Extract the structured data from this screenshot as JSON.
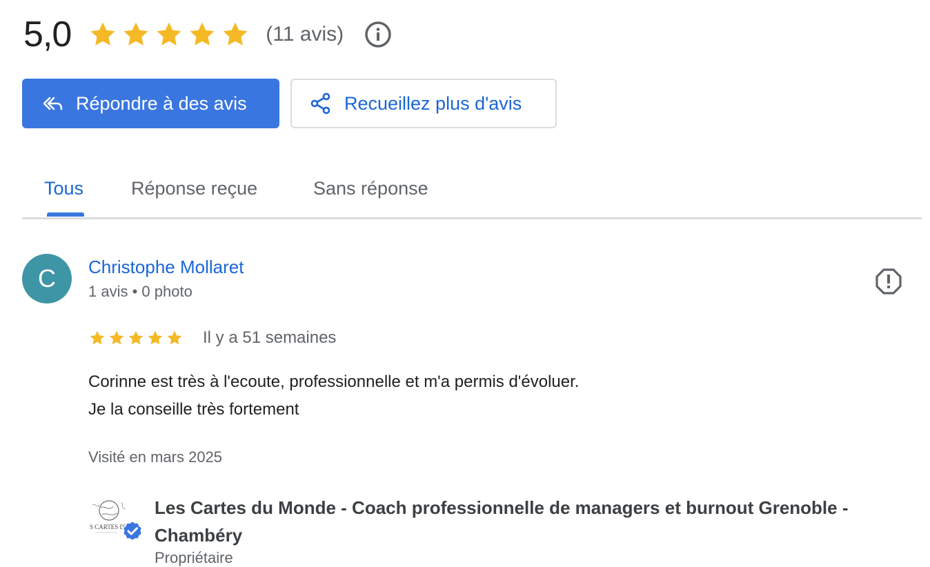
{
  "summary": {
    "rating": "5,0",
    "stars_filled": 5,
    "stars_total": 5,
    "review_count": "(11 avis)"
  },
  "actions": {
    "reply_label": "Répondre à des avis",
    "collect_label": "Recueillez plus d'avis"
  },
  "tabs": [
    {
      "label": "Tous",
      "active": true
    },
    {
      "label": "Réponse reçue",
      "active": false
    },
    {
      "label": "Sans réponse",
      "active": false
    }
  ],
  "review": {
    "avatar_letter": "C",
    "avatar_color": "#3e95a5",
    "reviewer_name": "Christophe Mollaret",
    "reviewer_meta": "1 avis • 0 photo",
    "stars": 5,
    "date": "Il y a 51 semaines",
    "text": "Corinne est très à l'ecoute, professionnelle et m'a permis d'évoluer.\nJe la conseille très fortement",
    "visited": "Visité en mars 2025"
  },
  "owner": {
    "logo_text": "S CARTES DU",
    "name": "Les Cartes du Monde - Coach professionnelle de managers et burnout Grenoble - Chambéry",
    "role": "Propriétaire"
  },
  "colors": {
    "accent": "#3a76e0",
    "link": "#1a66d6",
    "star": "#f4b925",
    "muted_text": "#5f6368"
  },
  "icons": {
    "info": "info-circle-icon",
    "reply": "reply-all-icon",
    "share": "share-icon",
    "flag": "report-octagon-icon",
    "verified": "verified-badge-icon",
    "star": "star-icon"
  }
}
